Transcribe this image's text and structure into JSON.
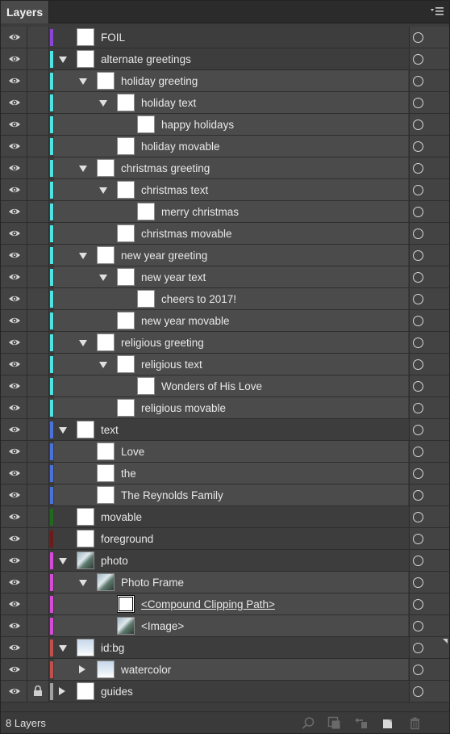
{
  "panel": {
    "tab_title": "Layers",
    "footer_count": "8 Layers"
  },
  "colors": {
    "purple": "#8a44d6",
    "cyan": "#4fe3e3",
    "blue": "#4a72d9",
    "dark_green": "#1f6a1f",
    "dark_red": "#6e1a1a",
    "magenta": "#d64bd6",
    "red": "#c0504d",
    "gray": "#a0a0a0"
  },
  "layers": [
    {
      "label": "FOIL",
      "depth": 0,
      "arrow": "",
      "thumb": "white",
      "color": "purple",
      "locked": false
    },
    {
      "label": "alternate greetings",
      "depth": 0,
      "arrow": "down",
      "thumb": "white",
      "color": "cyan",
      "locked": false
    },
    {
      "label": "holiday greeting",
      "depth": 1,
      "arrow": "down",
      "thumb": "white",
      "color": "cyan",
      "locked": false
    },
    {
      "label": "holiday text",
      "depth": 2,
      "arrow": "down",
      "thumb": "white",
      "color": "cyan",
      "locked": false
    },
    {
      "label": "happy holidays",
      "depth": 3,
      "arrow": "",
      "thumb": "white",
      "color": "cyan",
      "locked": false
    },
    {
      "label": "holiday movable",
      "depth": 2,
      "arrow": "",
      "thumb": "white",
      "color": "cyan",
      "locked": false
    },
    {
      "label": "christmas greeting",
      "depth": 1,
      "arrow": "down",
      "thumb": "white",
      "color": "cyan",
      "locked": false
    },
    {
      "label": "christmas text",
      "depth": 2,
      "arrow": "down",
      "thumb": "white",
      "color": "cyan",
      "locked": false
    },
    {
      "label": "merry christmas",
      "depth": 3,
      "arrow": "",
      "thumb": "white",
      "color": "cyan",
      "locked": false
    },
    {
      "label": "christmas movable",
      "depth": 2,
      "arrow": "",
      "thumb": "white",
      "color": "cyan",
      "locked": false
    },
    {
      "label": "new year greeting",
      "depth": 1,
      "arrow": "down",
      "thumb": "white",
      "color": "cyan",
      "locked": false
    },
    {
      "label": "new year text",
      "depth": 2,
      "arrow": "down",
      "thumb": "white",
      "color": "cyan",
      "locked": false
    },
    {
      "label": "cheers to 2017!",
      "depth": 3,
      "arrow": "",
      "thumb": "white",
      "color": "cyan",
      "locked": false
    },
    {
      "label": "new year movable",
      "depth": 2,
      "arrow": "",
      "thumb": "white",
      "color": "cyan",
      "locked": false
    },
    {
      "label": "religious greeting",
      "depth": 1,
      "arrow": "down",
      "thumb": "white",
      "color": "cyan",
      "locked": false
    },
    {
      "label": "religious text",
      "depth": 2,
      "arrow": "down",
      "thumb": "white",
      "color": "cyan",
      "locked": false
    },
    {
      "label": "Wonders of His Love",
      "depth": 3,
      "arrow": "",
      "thumb": "white",
      "color": "cyan",
      "locked": false
    },
    {
      "label": "religious movable",
      "depth": 2,
      "arrow": "",
      "thumb": "white",
      "color": "cyan",
      "locked": false
    },
    {
      "label": "text",
      "depth": 0,
      "arrow": "down",
      "thumb": "white",
      "color": "blue",
      "locked": false
    },
    {
      "label": "Love",
      "depth": 1,
      "arrow": "",
      "thumb": "white",
      "color": "blue",
      "locked": false
    },
    {
      "label": "the",
      "depth": 1,
      "arrow": "",
      "thumb": "white",
      "color": "blue",
      "locked": false
    },
    {
      "label": "The Reynolds Family",
      "depth": 1,
      "arrow": "",
      "thumb": "white",
      "color": "blue",
      "locked": false
    },
    {
      "label": "movable",
      "depth": 0,
      "arrow": "",
      "thumb": "white",
      "color": "dark_green",
      "locked": false
    },
    {
      "label": "foreground",
      "depth": 0,
      "arrow": "",
      "thumb": "white",
      "color": "dark_red",
      "locked": false
    },
    {
      "label": "photo",
      "depth": 0,
      "arrow": "down",
      "thumb": "photo",
      "color": "magenta",
      "locked": false
    },
    {
      "label": "Photo Frame",
      "depth": 1,
      "arrow": "down",
      "thumb": "photo",
      "color": "magenta",
      "locked": false
    },
    {
      "label": "<Compound Clipping Path>",
      "depth": 2,
      "arrow": "",
      "thumb": "clip",
      "color": "magenta",
      "locked": false,
      "underline": true
    },
    {
      "label": "<Image>",
      "depth": 2,
      "arrow": "",
      "thumb": "photo",
      "color": "magenta",
      "locked": false
    },
    {
      "label": "id:bg",
      "depth": 0,
      "arrow": "down",
      "thumb": "sky",
      "color": "red",
      "locked": false,
      "corner": true
    },
    {
      "label": "watercolor",
      "depth": 1,
      "arrow": "right",
      "thumb": "sky",
      "color": "red",
      "locked": false
    },
    {
      "label": "guides",
      "depth": 0,
      "arrow": "right",
      "thumb": "white",
      "color": "gray",
      "locked": true
    }
  ],
  "icons": {
    "visibility": "eye-icon",
    "lock": "lock-icon",
    "target": "target-circle-icon",
    "panel_menu": "panel-menu-icon",
    "footer": [
      "search-icon",
      "clipping-mask-icon",
      "sublayer-icon",
      "new-layer-icon",
      "trash-icon"
    ]
  }
}
